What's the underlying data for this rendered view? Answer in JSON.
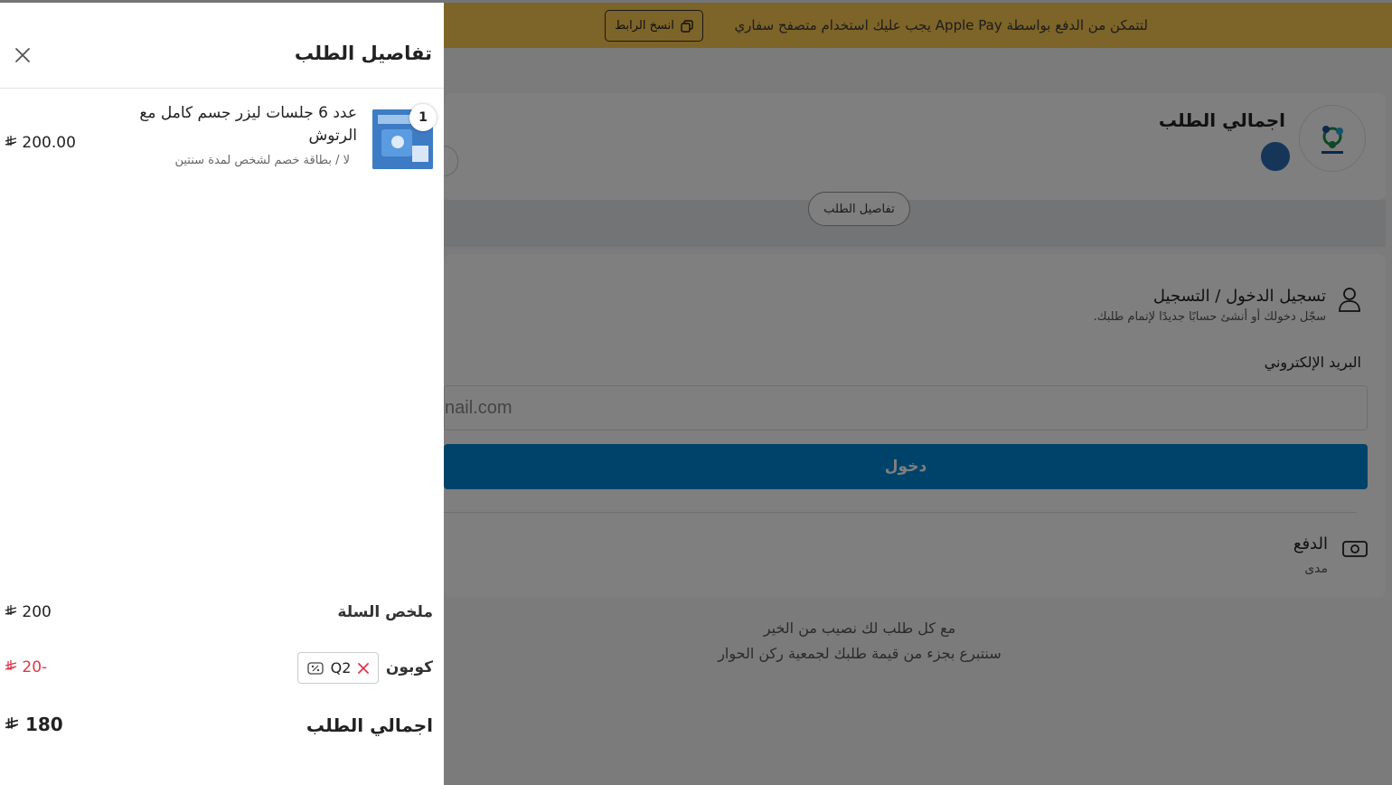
{
  "banner": {
    "text": "لتتمكن من الدفع بواسطة Apple Pay يجب عليك استخدام متصفح سفاري",
    "copy_label": "انسخ الرابط"
  },
  "summary": {
    "title": "اجمالي الطلب",
    "details_label": "تفاصيل الطلب"
  },
  "login": {
    "title": "تسجيل الدخول / التسجيل",
    "subtitle": "سجّل دخولك أو أنشئ حسابًا جديدًا لإتمام طلبك.",
    "email_label": "البريد الإلكتروني",
    "email_placeholder": "nail.com",
    "button_label": "دخول"
  },
  "payment": {
    "title": "الدفع",
    "method": "مدى"
  },
  "charity": {
    "line1": "مع كل طلب لك نصيب من الخير",
    "line2": "سنتبرع بجزء من قيمة طلبك لجمعية ركن الحوار"
  },
  "drawer": {
    "title": "تفاصيل الطلب",
    "item": {
      "quantity": "1",
      "name": "عدد 6 جلسات ليزر جسم كامل مع الرتوش",
      "variant": "لا / بطاقة خصم لشخص لمدة سنتين",
      "price": "200.00"
    },
    "cart_summary_label": "ملخص السلة",
    "cart_summary_value": "200",
    "coupon_label": "كوبون",
    "coupon_code": "Q2",
    "coupon_value": "20-",
    "total_label": "اجمالي الطلب",
    "total_value": "180"
  },
  "colors": {
    "banner": "#fac850",
    "primary_button": "#0087d5",
    "discount": "#e0364a",
    "overlay": "rgba(0,0,0,0.5)"
  },
  "icons": {
    "close": "close-icon",
    "copy": "copy-icon",
    "user": "user-icon",
    "payment": "cash-icon",
    "coupon": "coupon-icon",
    "remove": "remove-icon",
    "currency": "riyal-icon"
  }
}
